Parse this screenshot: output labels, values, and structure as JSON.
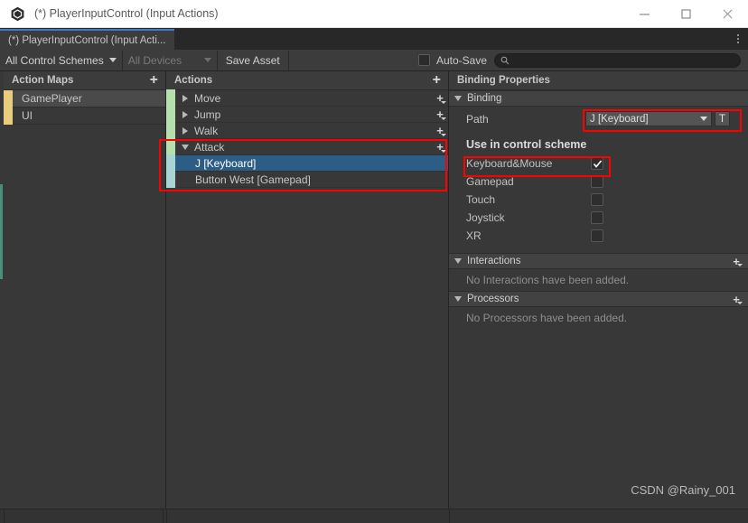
{
  "window": {
    "title": "(*) PlayerInputControl (Input Actions)",
    "icon": "unity-logo-icon",
    "minimize_label": "minimize-icon",
    "maximize_label": "maximize-icon",
    "close_label": "close-icon"
  },
  "tab": {
    "label": "(*) PlayerInputControl (Input Acti...",
    "menu_icon": "kebab-menu-icon"
  },
  "toolbar": {
    "control_schemes": "All Control Schemes",
    "devices": "All Devices",
    "save_asset": "Save Asset",
    "auto_save": "Auto-Save",
    "auto_save_checked": false,
    "search_placeholder": "",
    "search_value": "",
    "search_icon": "search-icon"
  },
  "action_maps": {
    "header": "Action Maps",
    "add_label": "+",
    "items": [
      {
        "label": "GamePlayer",
        "color": "#e8cd7f",
        "selected": true
      },
      {
        "label": "UI",
        "color": "#e8cd7f",
        "selected": false
      }
    ]
  },
  "actions": {
    "header": "Actions",
    "add_label": "+",
    "items": [
      {
        "label": "Move",
        "type": "action",
        "expanded": false,
        "color": "#b6dfae",
        "selected": false
      },
      {
        "label": "Jump",
        "type": "action",
        "expanded": false,
        "color": "#b6dfae",
        "selected": false
      },
      {
        "label": "Walk",
        "type": "action",
        "expanded": false,
        "color": "#b6dfae",
        "selected": false
      },
      {
        "label": "Attack",
        "type": "action",
        "expanded": true,
        "color": "#b6dfae",
        "selected": false
      },
      {
        "label": "J [Keyboard]",
        "type": "binding",
        "color": "#a9d4d4",
        "selected": true
      },
      {
        "label": "Button West [Gamepad]",
        "type": "binding",
        "color": "#a9d4d4",
        "selected": false
      }
    ]
  },
  "properties": {
    "header": "Binding Properties",
    "binding_section": "Binding",
    "path_label": "Path",
    "path_value": "J [Keyboard]",
    "path_button": "T",
    "scheme_title": "Use in control scheme",
    "schemes": [
      {
        "label": "Keyboard&Mouse",
        "checked": true
      },
      {
        "label": "Gamepad",
        "checked": false
      },
      {
        "label": "Touch",
        "checked": false
      },
      {
        "label": "Joystick",
        "checked": false
      },
      {
        "label": "XR",
        "checked": false
      }
    ],
    "interactions_section": "Interactions",
    "interactions_empty": "No Interactions have been added.",
    "processors_section": "Processors",
    "processors_empty": "No Processors have been added."
  },
  "watermark": "CSDN @Rainy_001",
  "colors": {
    "accent_blue": "#2c5d87",
    "tab_accent": "#3d7bc7",
    "annotation_red": "#ff0000",
    "panel_bg": "#383838",
    "header_bg": "#3c3c3c"
  }
}
